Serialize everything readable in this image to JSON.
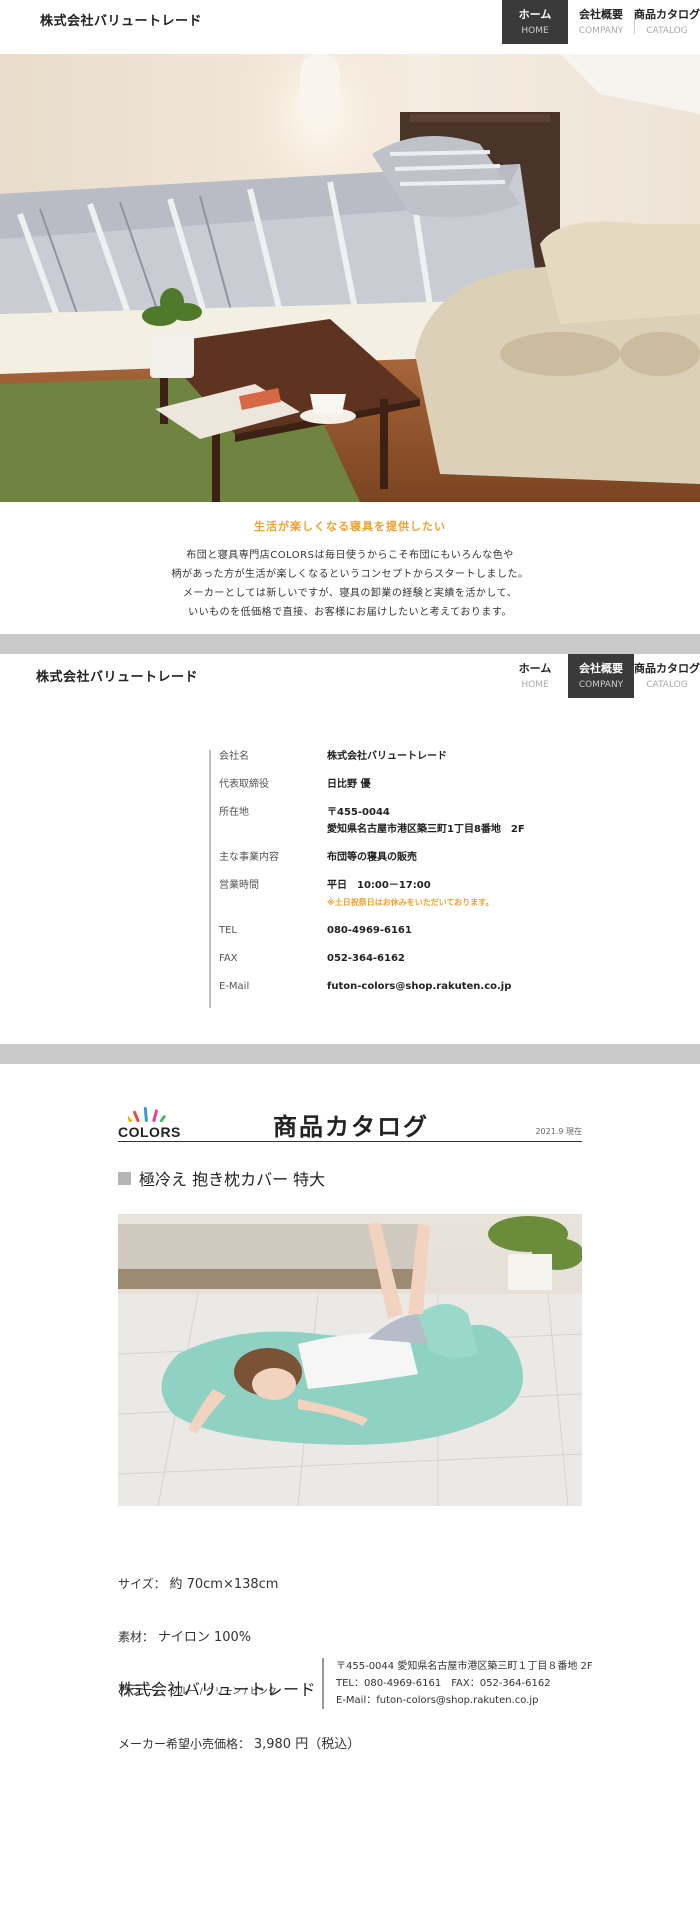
{
  "header": {
    "brand": "株式会社バリュートレード",
    "nav": [
      {
        "jp": "ホーム",
        "en": "HOME"
      },
      {
        "jp": "会社概要",
        "en": "COMPANY"
      },
      {
        "jp": "商品カタログ",
        "en": "CATALOG"
      }
    ]
  },
  "intro": {
    "tagline": "生活が楽しくなる寝具を提供したい",
    "lines": [
      "布団と寝具専門店COLORSは毎日使うからこそ布団にもいろんな色や",
      "柄があった方が生活が楽しくなるというコンセプトからスタートしました。",
      "メーカーとしては新しいですが、寝具の卸業の経験と実績を活かして、",
      "いいものを低価格で直接、お客様にお届けしたいと考えております。"
    ]
  },
  "company": {
    "rows": [
      {
        "key": "会社名",
        "value": "株式会社バリュートレード"
      },
      {
        "key": "代表取締役",
        "value": "日比野 優"
      },
      {
        "key": "所在地",
        "value": "〒455-0044",
        "value2": "愛知県名古屋市港区築三町1丁目8番地　2F"
      },
      {
        "key": "主な事業内容",
        "value": "布団等の寝具の販売"
      },
      {
        "key": "営業時間",
        "value": "平日　10:00－17:00",
        "note": "※土日祝祭日はお休みをいただいております。"
      },
      {
        "key": "TEL",
        "value": "080-4969-6161"
      },
      {
        "key": "FAX",
        "value": "052-364-6162"
      },
      {
        "key": "E-Mail",
        "value": "futon-colors@shop.rakuten.co.jp"
      }
    ]
  },
  "catalog": {
    "logo_text": "COLORS",
    "title": "商品カタログ",
    "date": "2021.9 現在",
    "product_name": "極冷え 抱き枕カバー 特大",
    "specs": [
      {
        "label": "サイズ：",
        "value": "約 70cm×138cm"
      },
      {
        "label": "素材：",
        "value": "ナイロン 100%"
      },
      {
        "label": "カラー：",
        "value": "ブルー / グリーン / ピンク"
      },
      {
        "label": "メーカー希望小売価格：",
        "value": "3,980 円（税込）"
      }
    ]
  },
  "footer": {
    "brand": "株式会社バリュートレード",
    "address": "〒455-0044 愛知県名古屋市港区築三町１丁目８番地 2F",
    "contact": "TEL：080-4969-6161　FAX：052-364-6162",
    "email": "E-Mail：futon-colors@shop.rakuten.co.jp"
  },
  "colors": {
    "accent": "#f0a030",
    "nav_active": "#3a3a3a",
    "band": "#c9c9c9"
  }
}
